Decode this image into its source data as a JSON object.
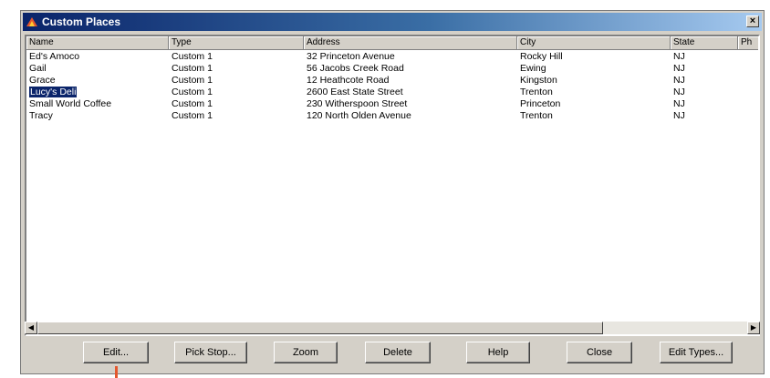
{
  "window": {
    "title": "Custom Places",
    "close_glyph": "×"
  },
  "list": {
    "columns": [
      "Name",
      "Type",
      "Address",
      "City",
      "State",
      "Ph"
    ],
    "rows": [
      {
        "name": "Ed's Amoco",
        "type": "Custom 1",
        "address": "32 Princeton Avenue",
        "city": "Rocky Hill",
        "state": "NJ"
      },
      {
        "name": "Gail",
        "type": "Custom 1",
        "address": "56 Jacobs Creek Road",
        "city": "Ewing",
        "state": "NJ"
      },
      {
        "name": "Grace",
        "type": "Custom 1",
        "address": "12 Heathcote Road",
        "city": "Kingston",
        "state": "NJ"
      },
      {
        "name": "Lucy's Deli",
        "type": "Custom 1",
        "address": "2600 East State Street",
        "city": "Trenton",
        "state": "NJ",
        "selected": true
      },
      {
        "name": "Small World Coffee",
        "type": "Custom 1",
        "address": "230 Witherspoon Street",
        "city": "Princeton",
        "state": "NJ"
      },
      {
        "name": "Tracy",
        "type": "Custom 1",
        "address": "120 North Olden Avenue",
        "city": "Trenton",
        "state": "NJ"
      }
    ]
  },
  "scrollbar": {
    "left_glyph": "◀",
    "right_glyph": "▶"
  },
  "buttons": {
    "edit": "Edit...",
    "pick_stop": "Pick Stop...",
    "zoom": "Zoom",
    "delete": "Delete",
    "help": "Help",
    "close": "Close",
    "edit_types": "Edit Types..."
  },
  "colors": {
    "selection": "#0a246a",
    "titlebar": "#0a246a",
    "pointer": "#e4572e"
  }
}
